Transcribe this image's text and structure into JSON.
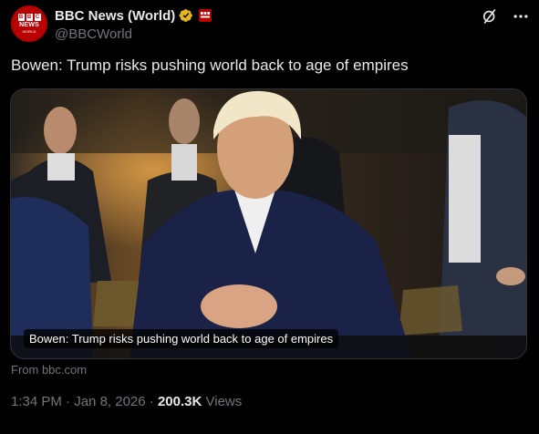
{
  "account": {
    "display_name": "BBC News (World)",
    "handle": "@BBCWorld",
    "avatar_text": "NEWS",
    "avatar_subtext": "WORLD",
    "avatar_blocks": [
      "B",
      "B",
      "C"
    ],
    "verified_badge_color": "#e2b719",
    "affiliate_badge_color": "#b80000"
  },
  "actions": {
    "grok_icon": "grok-icon",
    "more_icon": "more-icon"
  },
  "tweet": {
    "text": "Bowen: Trump risks pushing world back to age of empires"
  },
  "card": {
    "caption": "Bowen: Trump risks pushing world back to age of empires",
    "source": "From bbc.com"
  },
  "meta": {
    "time": "1:34 PM",
    "separator": " · ",
    "date": "Jan 8, 2026",
    "views_count": "200.3K",
    "views_label": " Views"
  },
  "colors": {
    "background": "#000000",
    "text": "#e7e9ea",
    "muted": "#71767b",
    "border": "#2f3336"
  }
}
